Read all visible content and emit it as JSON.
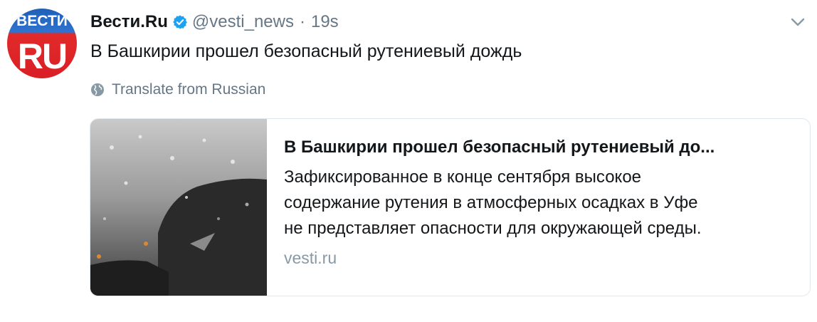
{
  "avatar": {
    "top_text": "ВЕСТИ",
    "bottom_text": "RU"
  },
  "tweet": {
    "author_name": "Вести.Ru",
    "handle": "@vesti_news",
    "separator": "·",
    "time": "19s",
    "text": "В Башкирии прошел безопасный рутениевый дождь",
    "translate_label": "Translate from Russian"
  },
  "card": {
    "title": "В Башкирии прошел безопасный рутениевый до...",
    "description_lines": [
      "Зафиксированное в конце сентября высокое",
      "содержание рутения в атмосферных осадках в Уфе",
      "не представляет опасности для окружающей среды."
    ],
    "domain": "vesti.ru"
  },
  "icons": {
    "verified": "verified-badge-icon",
    "menu": "chevron-down-icon",
    "translate": "globe-icon"
  },
  "colors": {
    "verified_blue": "#1da1f2",
    "secondary_text": "#657786",
    "domain_text": "#8899a6",
    "border": "#e1e8ed"
  }
}
